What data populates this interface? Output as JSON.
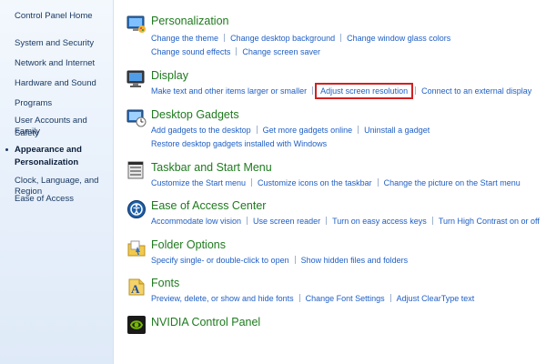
{
  "sidebar": {
    "items": [
      {
        "label": "Control Panel Home"
      },
      {
        "label": "System and Security"
      },
      {
        "label": "Network and Internet"
      },
      {
        "label": "Hardware and Sound"
      },
      {
        "label": "Programs"
      },
      {
        "label": "User Accounts and Family"
      },
      {
        "label": "Safety"
      },
      {
        "label": "Appearance and"
      },
      {
        "label": "Personalization"
      },
      {
        "label": "Clock, Language, and Region"
      },
      {
        "label": "Ease of Access"
      }
    ]
  },
  "categories": {
    "personalization": {
      "title": "Personalization",
      "tasks": [
        "Change the theme",
        "Change desktop background",
        "Change window glass colors",
        "Change sound effects",
        "Change screen saver"
      ]
    },
    "display": {
      "title": "Display",
      "tasks": [
        "Make text and other items larger or smaller",
        "Adjust screen resolution",
        "Connect to an external display"
      ]
    },
    "gadgets": {
      "title": "Desktop Gadgets",
      "tasks": [
        "Add gadgets to the desktop",
        "Get more gadgets online",
        "Uninstall a gadget",
        "Restore desktop gadgets installed with Windows"
      ]
    },
    "taskbar": {
      "title": "Taskbar and Start Menu",
      "tasks": [
        "Customize the Start menu",
        "Customize icons on the taskbar",
        "Change the picture on the Start menu"
      ]
    },
    "ease": {
      "title": "Ease of Access Center",
      "tasks": [
        "Accommodate low vision",
        "Use screen reader",
        "Turn on easy access keys",
        "Turn High Contrast on or off"
      ]
    },
    "folder": {
      "title": "Folder Options",
      "tasks": [
        "Specify single- or double-click to open",
        "Show hidden files and folders"
      ]
    },
    "fonts": {
      "title": "Fonts",
      "tasks": [
        "Preview, delete, or show and hide fonts",
        "Change Font Settings",
        "Adjust ClearType text"
      ]
    },
    "nvidia": {
      "title": "NVIDIA Control Panel",
      "tasks": []
    }
  },
  "colors": {
    "title_green": "#1e7a1e",
    "link_blue": "#1f5fc5",
    "highlight_red": "#d22020"
  },
  "icons": [
    "personalization-icon",
    "display-icon",
    "gadgets-icon",
    "taskbar-icon",
    "ease-of-access-icon",
    "folder-icon",
    "fonts-icon",
    "nvidia-icon"
  ]
}
